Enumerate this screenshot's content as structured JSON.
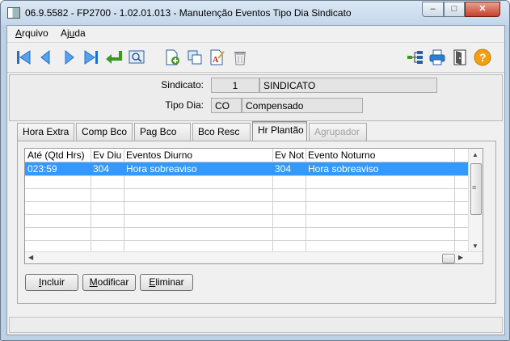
{
  "window": {
    "title": "06.9.5582 - FP2700 - 1.02.01.013 - Manutenção Eventos Tipo Dia Sindicato",
    "minimize": "–",
    "maximize": "□",
    "close": "✕"
  },
  "menu": {
    "arquivo_u": "A",
    "arquivo_rest": "rquivo",
    "ajuda_pre": "Aj",
    "ajuda_u": "u",
    "ajuda_rest": "da"
  },
  "toolbar": {
    "icons": [
      "first-icon",
      "prev-icon",
      "next-icon",
      "last-icon",
      "return-icon",
      "zoom-icon",
      "new-icon",
      "copy-icon",
      "edit-icon",
      "delete-icon",
      "structure-icon",
      "print-icon",
      "exit-icon",
      "help-icon"
    ],
    "help_glyph": "?"
  },
  "form": {
    "sindicato_label": "Sindicato:",
    "sindicato_code": "1",
    "sindicato_name": "SINDICATO",
    "tipo_dia_label": "Tipo Dia:",
    "tipo_dia_code": "CO",
    "tipo_dia_name": "Compensado"
  },
  "tabs": [
    "Hora Extra",
    "Comp Bco",
    "Pag Bco",
    "Bco Resc",
    "Hr Plantão",
    "Agrupador"
  ],
  "active_tab": "Hr Plantão",
  "grid": {
    "columns": [
      "Até (Qtd Hrs)",
      "Ev Diu",
      "Eventos Diurno",
      "Ev Not",
      "Evento Noturno"
    ],
    "rows": [
      [
        "023:59",
        "304",
        "Hora sobreaviso",
        "304",
        "Hora sobreaviso"
      ]
    ]
  },
  "scroll": {
    "up": "▲",
    "down": "▼",
    "left": "◀",
    "right": "▶",
    "grip": "≡"
  },
  "buttons": {
    "incluir_u": "I",
    "incluir_rest": "ncluir",
    "modificar_u": "M",
    "modificar_rest": "odificar",
    "eliminar_u": "E",
    "eliminar_rest": "liminar"
  },
  "colors": {
    "selection": "#3399ff",
    "accent_blue": "#1e6fd0",
    "help_orange": "#f0a010"
  }
}
